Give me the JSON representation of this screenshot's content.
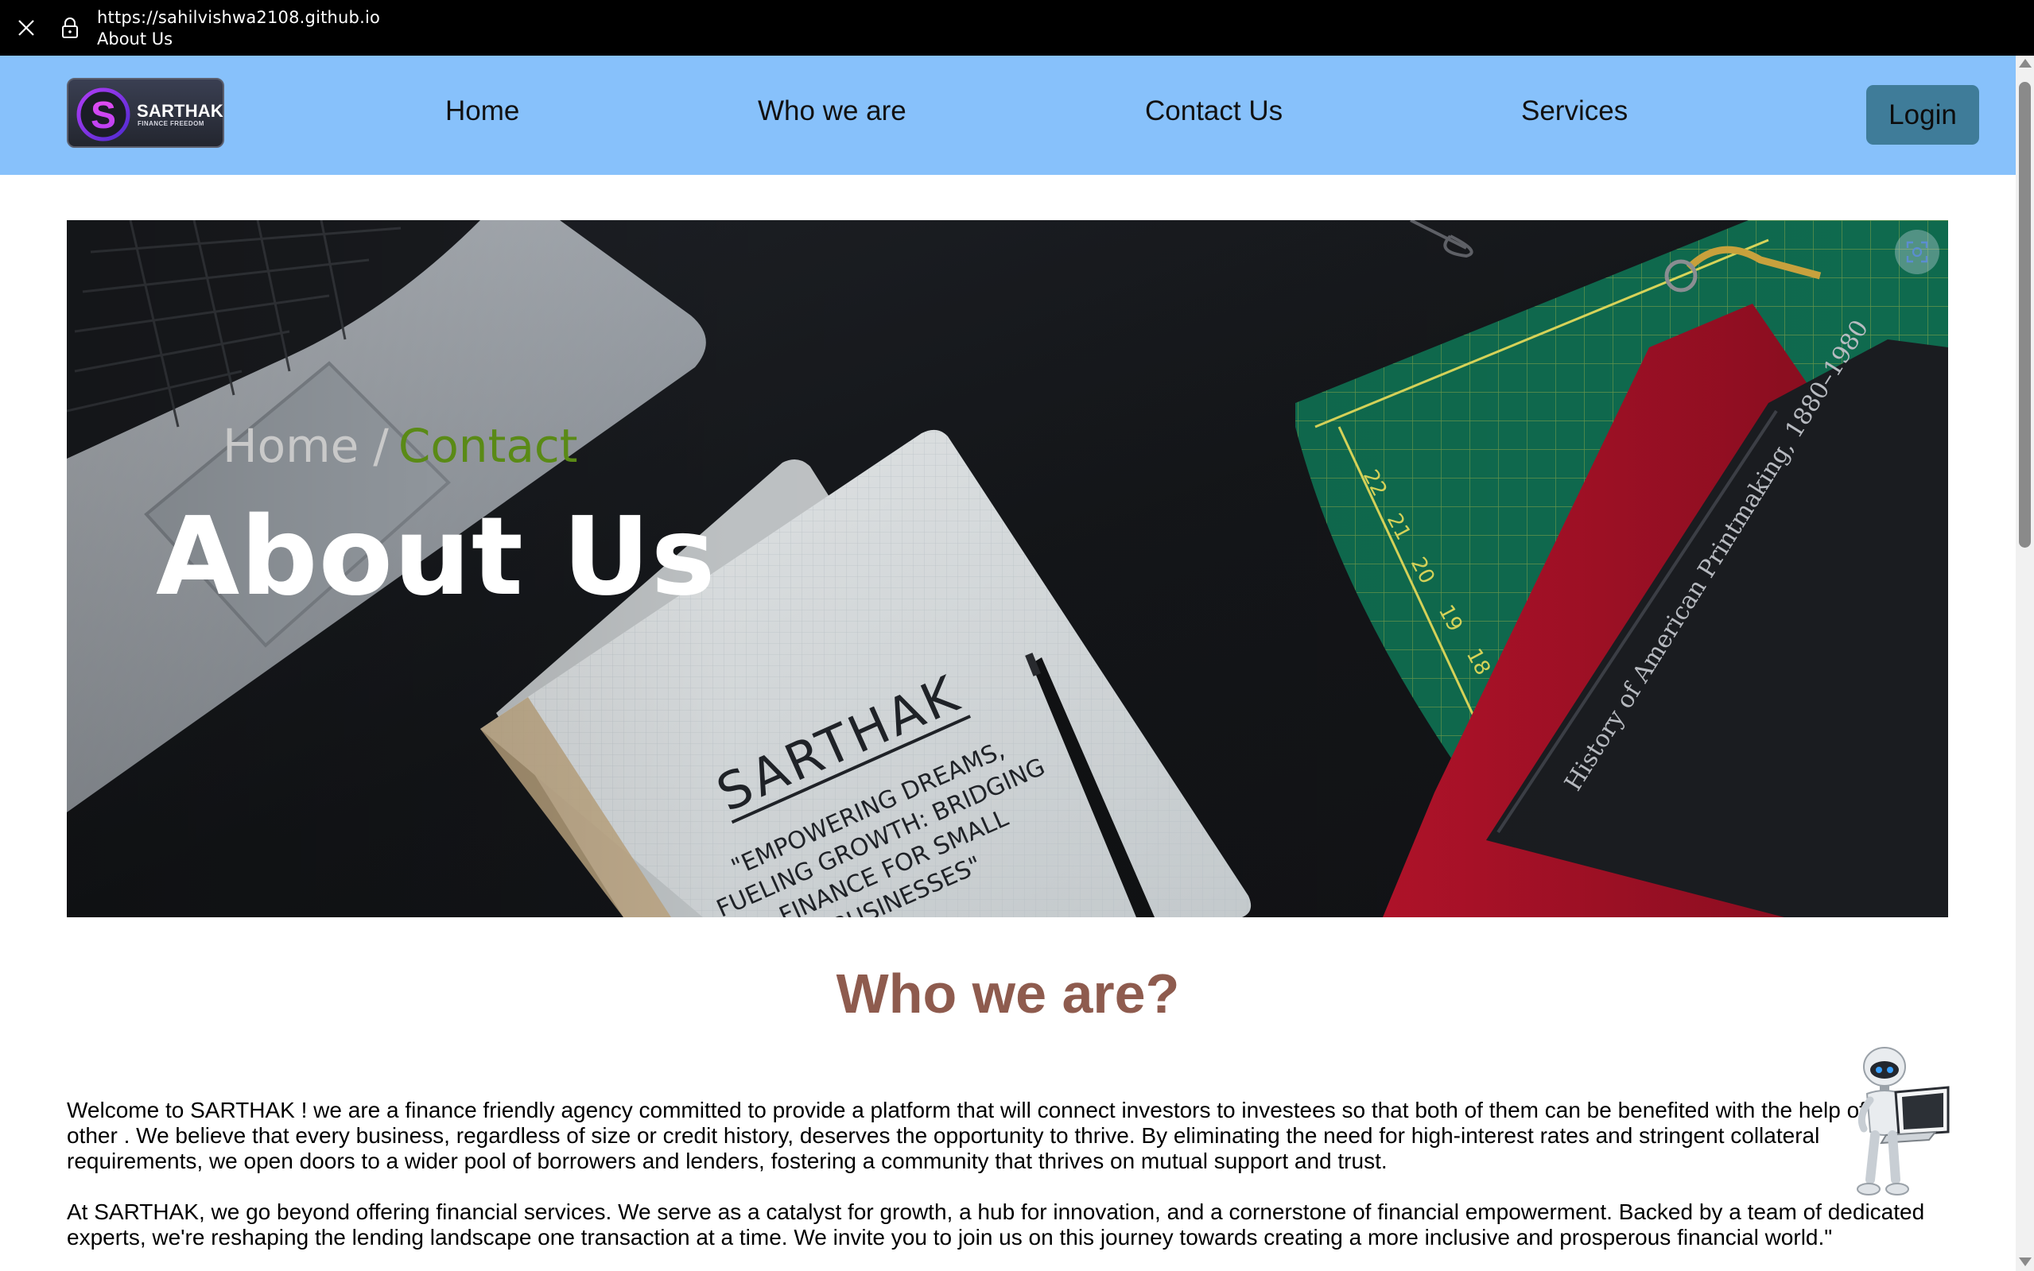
{
  "browser": {
    "url": "https://sahilvishwa2108.github.io",
    "page_title": "About Us"
  },
  "nav": {
    "logo": {
      "name": "SARTHAK",
      "tagline": "FINANCE FREEDOM",
      "mark_letter": "S"
    },
    "links": [
      "Home",
      "Who we are",
      "Contact Us",
      "Services"
    ],
    "login_label": "Login"
  },
  "hero": {
    "breadcrumb": {
      "home": "Home",
      "separator": "/",
      "current": "Contact"
    },
    "title": "About Us",
    "notebook": {
      "brand": "SARTHAK",
      "slogan_lines": [
        "\"EMPOWERING DREAMS,",
        "FUELING GROWTH: BRIDGING",
        "FINANCE FOR SMALL",
        "BUSINESSES\""
      ]
    }
  },
  "about": {
    "heading": "Who we are?",
    "paragraphs": [
      "Welcome to SARTHAK ! we are a finance friendly agency committed to provide a platform that will connect investors to investees so that both of them can be benefited with the help of each other . We believe that every business, regardless of size or credit history, deserves the opportunity to thrive. By eliminating the need for high-interest rates and stringent collateral requirements, we open doors to a wider pool of borrowers and lenders, fostering a community that thrives on mutual support and trust.",
      "At SARTHAK, we go beyond offering financial services. We serve as a catalyst for growth, a hub for innovation, and a cornerstone of financial empowerment. Backed by a team of dedicated experts, we're reshaping the lending landscape one transaction at a time. We invite you to join us on this journey towards creating a more inclusive and prosperous financial world.\""
    ]
  },
  "colors": {
    "chrome": "#000000",
    "nav_background": "#87c1fb",
    "login_button": "#3f7c99",
    "breadcrumb_current": "#5a8a16",
    "heading": "#8e5b4e"
  },
  "icons": [
    "close-icon",
    "lock-icon",
    "screenshot-icon",
    "robot-assistant-icon"
  ]
}
